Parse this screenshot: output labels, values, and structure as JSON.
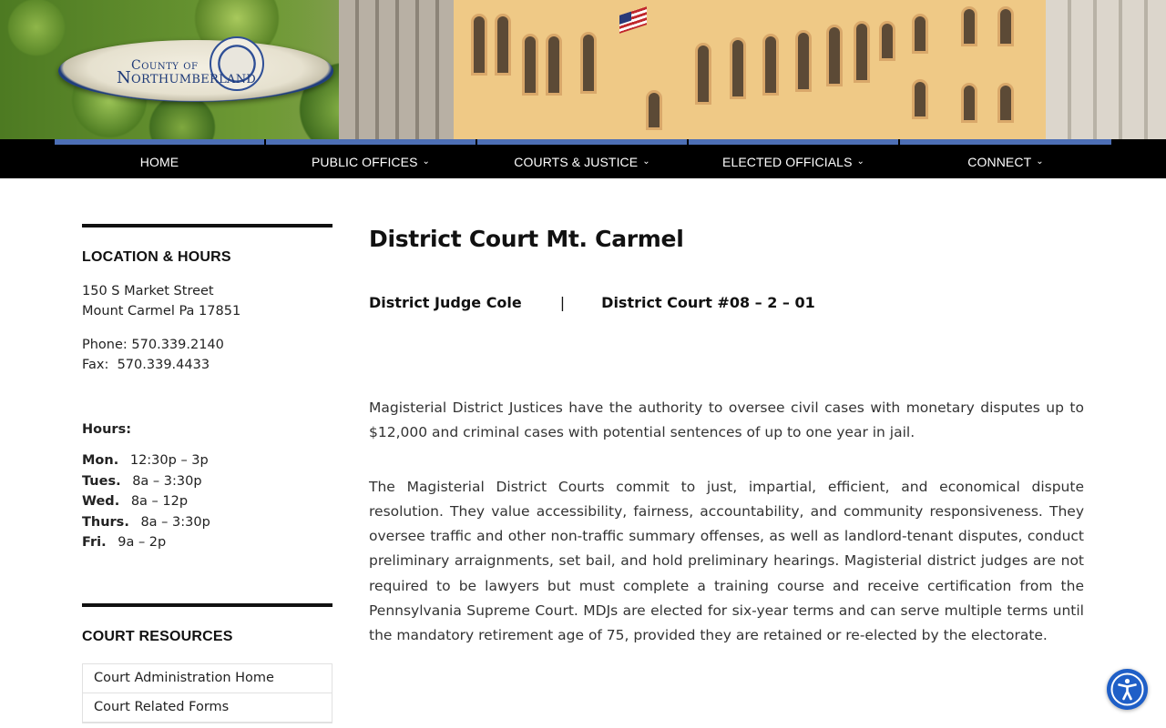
{
  "header": {
    "logo_line1": "County of",
    "logo_line2": "Northumberland"
  },
  "nav": {
    "items": [
      {
        "label": "HOME",
        "has_dropdown": false
      },
      {
        "label": "PUBLIC OFFICES",
        "has_dropdown": true
      },
      {
        "label": "COURTS & JUSTICE",
        "has_dropdown": true
      },
      {
        "label": "ELECTED OFFICIALS",
        "has_dropdown": true
      },
      {
        "label": "CONNECT",
        "has_dropdown": true
      }
    ],
    "accent_color": "#4d6fb5"
  },
  "sidebar": {
    "location_title": "LOCATION & HOURS",
    "address_line1": "150 S Market Street",
    "address_line2": "Mount Carmel Pa 17851",
    "phone": "Phone: 570.339.2140",
    "fax": "Fax:  570.339.4433",
    "hours_title": "Hours:",
    "hours": [
      {
        "day": "Mon.",
        "time": "12:30p – 3p"
      },
      {
        "day": "Tues.",
        "time": "8a – 3:30p"
      },
      {
        "day": "Wed.",
        "time": "8a – 12p"
      },
      {
        "day": "Thurs.",
        "time": "8a – 3:30p"
      },
      {
        "day": "Fri.",
        "time": "9a – 2p"
      }
    ],
    "resources_title": "COURT RESOURCES",
    "resources": [
      "Court Administration Home",
      "Court Related Forms"
    ]
  },
  "main": {
    "title": "District Court Mt. Carmel",
    "judge": "District Judge Cole",
    "separator": "|",
    "court_number": "District Court #08 – 2 – 01",
    "paragraph1": "Magisterial District Justices have the authority to oversee civil cases with monetary disputes up to $12,000 and criminal cases with potential sentences of up to one year in jail.",
    "paragraph2": "The Magisterial District Courts commit to just, impartial, efficient, and economical dispute resolution. They value accessibility, fairness, accountability, and community responsiveness. They oversee traffic and other non-traffic summary offenses, as well as landlord-tenant disputes, conduct preliminary arraignments, set bail, and hold preliminary hearings. Magisterial district judges are not required to be lawyers but must complete a training course and receive certification from the Pennsylvania Supreme Court. MDJs are elected for six-year terms and can serve multiple terms until the mandatory retirement age of 75, provided they are retained or re-elected by the electorate."
  },
  "accessibility": {
    "icon": "accessibility-icon",
    "color": "#1f5fc7"
  }
}
